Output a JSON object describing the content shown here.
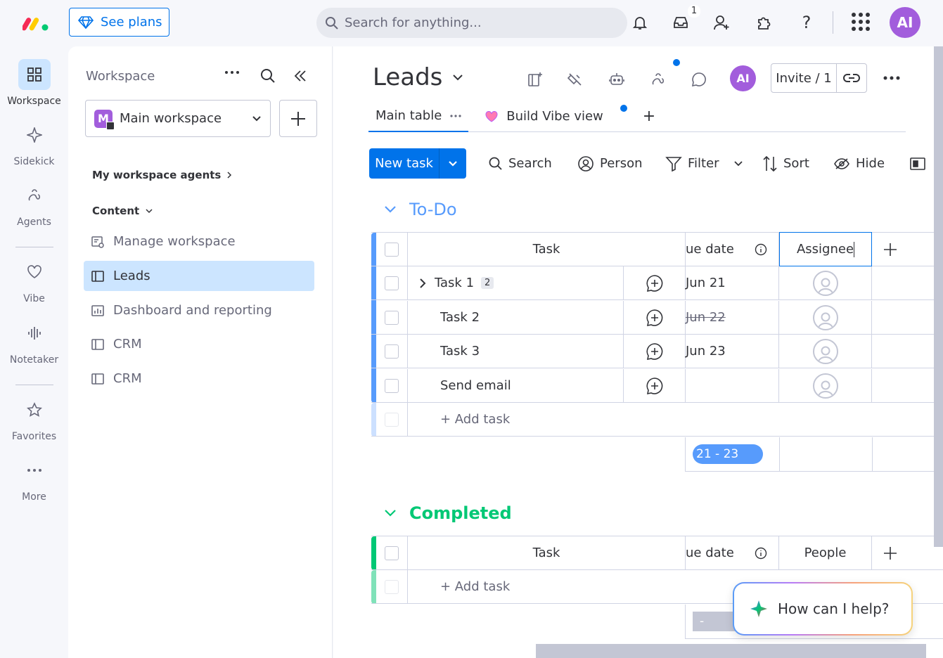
{
  "topbar": {
    "see_plans": "See plans",
    "search_placeholder": "Search for anything...",
    "inbox_count": "1",
    "avatar": "AI",
    "icons": [
      "bell-icon",
      "inbox-icon",
      "invite-user-icon",
      "integrations-icon",
      "help-icon",
      "apps-grid-icon"
    ]
  },
  "rail": {
    "items": [
      {
        "label": "Workspace",
        "icon": "workspace-grid-icon",
        "active": true
      },
      {
        "label": "Sidekick",
        "icon": "sidekick-sparkle-icon"
      },
      {
        "label": "Agents",
        "icon": "agents-icon"
      },
      {
        "label": "Vibe",
        "icon": "vibe-heart-icon"
      },
      {
        "label": "Notetaker",
        "icon": "notetaker-waveform-icon"
      },
      {
        "label": "Favorites",
        "icon": "star-icon"
      },
      {
        "label": "More",
        "icon": "more-dots-icon"
      }
    ]
  },
  "panel": {
    "title": "Workspace",
    "workspace_name": "Main workspace",
    "workspace_initial": "M",
    "agents_section": "My workspace agents",
    "content_section": "Content",
    "items": [
      {
        "label": "Manage workspace",
        "icon": "manage-workspace-icon"
      },
      {
        "label": "Leads",
        "icon": "board-icon",
        "active": true
      },
      {
        "label": "Dashboard and reporting",
        "icon": "dashboard-icon"
      },
      {
        "label": "CRM",
        "icon": "board-icon"
      },
      {
        "label": "CRM",
        "icon": "board-icon"
      }
    ]
  },
  "board": {
    "title": "Leads",
    "avatar": "AI",
    "invite": "Invite / 1",
    "tabs": [
      {
        "label": "Main table",
        "active": true
      },
      {
        "label": "Build Vibe view"
      }
    ],
    "add_tab": "+",
    "toolbar": {
      "new_task": "New task",
      "search": "Search",
      "person": "Person",
      "filter": "Filter",
      "sort": "Sort",
      "hide": "Hide"
    },
    "colors": {
      "accent": "#0073ea",
      "todo": "#579bfc",
      "done": "#00c875"
    },
    "groups": [
      {
        "title": "To-Do",
        "columns": {
          "task": "Task",
          "due": "ue date",
          "people": "Assignee"
        },
        "rows": [
          {
            "task": "Task 1",
            "subitems": "2",
            "expand": true,
            "due": "Jun 21",
            "strike": false
          },
          {
            "task": "Task 2",
            "due": "Jun 22",
            "strike": true
          },
          {
            "task": "Task 3",
            "due": "Jun 23",
            "strike": false
          },
          {
            "task": "Send email",
            "due": "",
            "strike": false
          }
        ],
        "add": "+ Add task",
        "summary": "21 - 23"
      },
      {
        "title": "Completed",
        "columns": {
          "task": "Task",
          "due": "ue date",
          "people": "People"
        },
        "rows": [],
        "add": "+ Add task",
        "summary": "-"
      }
    ]
  },
  "assistant": {
    "prompt": "How can I help?"
  }
}
